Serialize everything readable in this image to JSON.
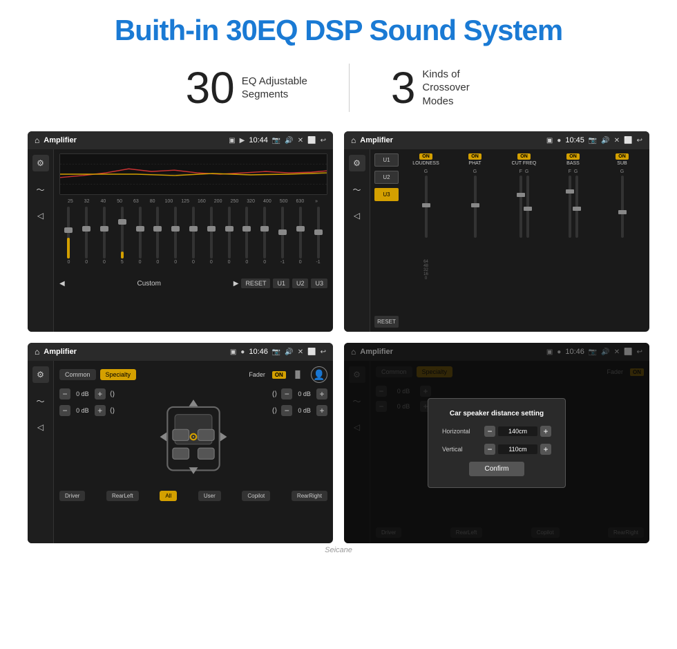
{
  "title": "Buith-in 30EQ DSP Sound System",
  "stat1_number": "30",
  "stat1_label_line1": "EQ Adjustable",
  "stat1_label_line2": "Segments",
  "stat2_number": "3",
  "stat2_label_line1": "Kinds of",
  "stat2_label_line2": "Crossover Modes",
  "screen1": {
    "topbar_title": "Amplifier",
    "topbar_time": "10:44",
    "eq_freqs": [
      "25",
      "32",
      "40",
      "50",
      "63",
      "80",
      "100",
      "125",
      "160",
      "200",
      "250",
      "320",
      "400",
      "500",
      "630"
    ],
    "eq_vals": [
      "0",
      "0",
      "0",
      "5",
      "0",
      "0",
      "0",
      "0",
      "0",
      "0",
      "0",
      "0",
      "-1",
      "0",
      "-1"
    ],
    "bottom_label": "Custom",
    "btns": [
      "RESET",
      "U1",
      "U2",
      "U3"
    ]
  },
  "screen2": {
    "topbar_title": "Amplifier",
    "topbar_time": "10:45",
    "presets": [
      "U1",
      "U2",
      "U3"
    ],
    "active_preset": "U3",
    "channels": [
      {
        "name": "LOUDNESS",
        "on": true,
        "labels": [
          "G"
        ]
      },
      {
        "name": "PHAT",
        "on": true,
        "labels": [
          "G"
        ]
      },
      {
        "name": "CUT FREQ",
        "on": true,
        "labels": [
          "F",
          "G"
        ]
      },
      {
        "name": "BASS",
        "on": true,
        "labels": [
          "F",
          "G"
        ]
      },
      {
        "name": "SUB",
        "on": true,
        "labels": [
          "G"
        ]
      }
    ],
    "reset_btn": "RESET"
  },
  "screen3": {
    "topbar_title": "Amplifier",
    "topbar_time": "10:46",
    "tabs": [
      "Common",
      "Specialty"
    ],
    "active_tab": "Specialty",
    "fader_label": "Fader",
    "fader_on": "ON",
    "vol_rows": [
      {
        "label": "0 dB"
      },
      {
        "label": "0 dB"
      },
      {
        "label": "0 dB"
      },
      {
        "label": "0 dB"
      }
    ],
    "bottom_btns": [
      "Driver",
      "RearLeft",
      "All",
      "User",
      "Copilot",
      "RearRight"
    ],
    "active_bottom": "All"
  },
  "screen4": {
    "topbar_title": "Amplifier",
    "topbar_time": "10:46",
    "dialog": {
      "title": "Car speaker distance setting",
      "horizontal_label": "Horizontal",
      "horizontal_value": "140cm",
      "vertical_label": "Vertical",
      "vertical_value": "110cm",
      "confirm_btn": "Confirm"
    },
    "bottom_btns_visible": [
      "Driver",
      "RearLeft",
      "All",
      "Copilot",
      "RearRight"
    ]
  },
  "watermark": "Seicane"
}
